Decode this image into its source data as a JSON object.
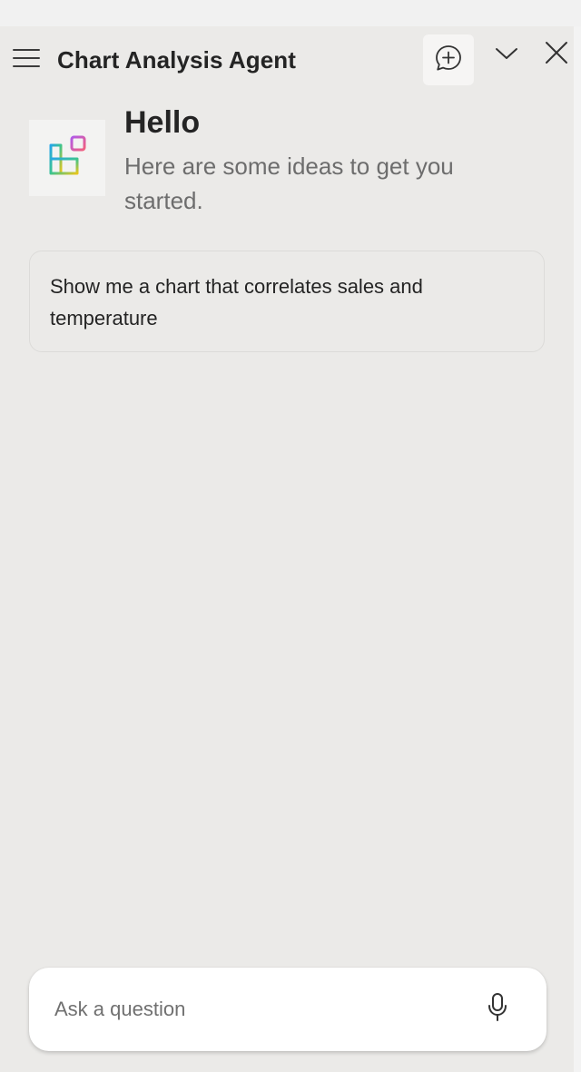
{
  "header": {
    "title": "Chart Analysis Agent",
    "icons": {
      "menu": "hamburger-menu-icon",
      "new_chat": "chat-add-icon",
      "collapse": "chevron-down-icon",
      "close": "close-icon"
    }
  },
  "greeting": {
    "logo_icon": "agent-logo-icon",
    "title": "Hello",
    "subtitle": "Here are some ideas to get you started."
  },
  "suggestions": [
    {
      "text": "Show me a chart that correlates sales and temperature"
    }
  ],
  "composer": {
    "placeholder": "Ask a question",
    "value": "",
    "mic_icon": "microphone-icon"
  },
  "colors": {
    "pane_background": "#ebeae8",
    "text_primary": "#242424",
    "text_secondary": "#6d6d6d"
  }
}
